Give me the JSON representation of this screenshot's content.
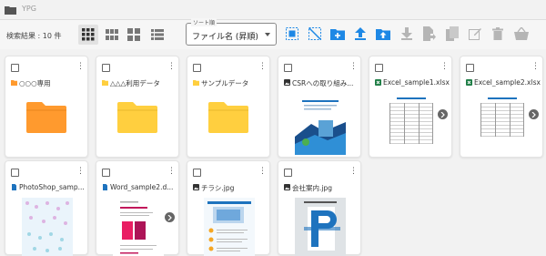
{
  "app": {
    "breadcrumb": "YPG"
  },
  "toolbar": {
    "result_label": "検索結果 : 10 件",
    "sort_legend": "ソート順",
    "sort_value": "ファイル名 (昇順)"
  },
  "colors": {
    "folder_orange": "#ff9a2e",
    "folder_yellow": "#ffcf3f",
    "accent_blue": "#1e88e5"
  },
  "items": [
    {
      "name": "○○○専用",
      "type": "folder",
      "color": "#ff9a2e"
    },
    {
      "name": "△△△利用データ",
      "type": "folder",
      "color": "#ffcf3f"
    },
    {
      "name": "サンプルデータ",
      "type": "folder",
      "color": "#ffcf3f"
    },
    {
      "name": "CSRへの取り組み...",
      "type": "image"
    },
    {
      "name": "Excel_sample1.xlsx",
      "type": "excel"
    },
    {
      "name": "Excel_sample2.xlsx",
      "type": "excel"
    },
    {
      "name": "PhotoShop_samp...",
      "type": "doc"
    },
    {
      "name": "Word_sample2.d...",
      "type": "doc"
    },
    {
      "name": "チラシ.jpg",
      "type": "image"
    },
    {
      "name": "会社案内.jpg",
      "type": "image"
    }
  ]
}
